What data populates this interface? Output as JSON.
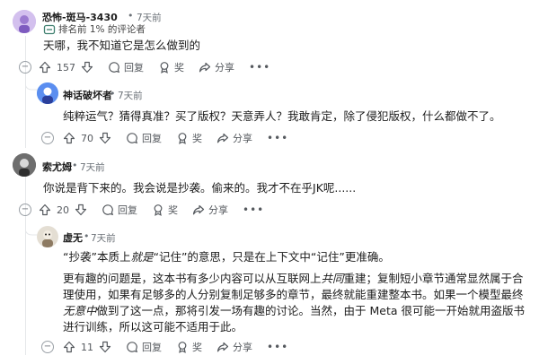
{
  "comments": [
    {
      "username": "恐怖-斑马-3430",
      "time": "7天前",
      "badge": "排名前 1% 的评论者",
      "text": "天哪，我不知道它是怎么做到的",
      "votes": "157",
      "reply_label": "回复",
      "award_label": "奖",
      "share_label": "分享"
    },
    {
      "username": "神话破坏者",
      "time": "7天前",
      "text": "纯粹运气？猜得真准？买了版权？天意弄人？我敢肯定，除了侵犯版权，什么都做不了。",
      "votes": "70",
      "reply_label": "回复",
      "award_label": "奖",
      "share_label": "分享"
    },
    {
      "username": "索尤姆",
      "time": "7天前",
      "text": "你说是背下来的。我会说是抄袭。偷来的。我才不在乎JK呢......",
      "votes": "20",
      "reply_label": "回复",
      "award_label": "奖",
      "share_label": "分享"
    },
    {
      "username": "虚无",
      "time": "7天前",
      "para1": {
        "a": "“抄袭”本质上",
        "em": "就是",
        "b": "“记住”的意思，只是在上下文中“记住”更准确。"
      },
      "para2": {
        "a": "更有趣的问题是，这本书有多少内容可以从互联网上",
        "em1": "共同",
        "b": "重建；复制短小章节通常显然属于合理使用，如果有足够多的人分别复制足够多的章节，最终就能重建整本书。如果一个模型最终",
        "em2": "无意中",
        "c": "做到了这一点，那将引发一场有趣的讨论。当然，由于 Meta 很可能一开始就用盗版书进行训练，所以这可能不适用于此。"
      },
      "votes": "11",
      "reply_label": "回复",
      "award_label": "奖",
      "share_label": "分享"
    }
  ],
  "dot": "•",
  "more": "•••",
  "colors": {
    "thread": "#e5e7ea",
    "muted": "#6b7177"
  }
}
